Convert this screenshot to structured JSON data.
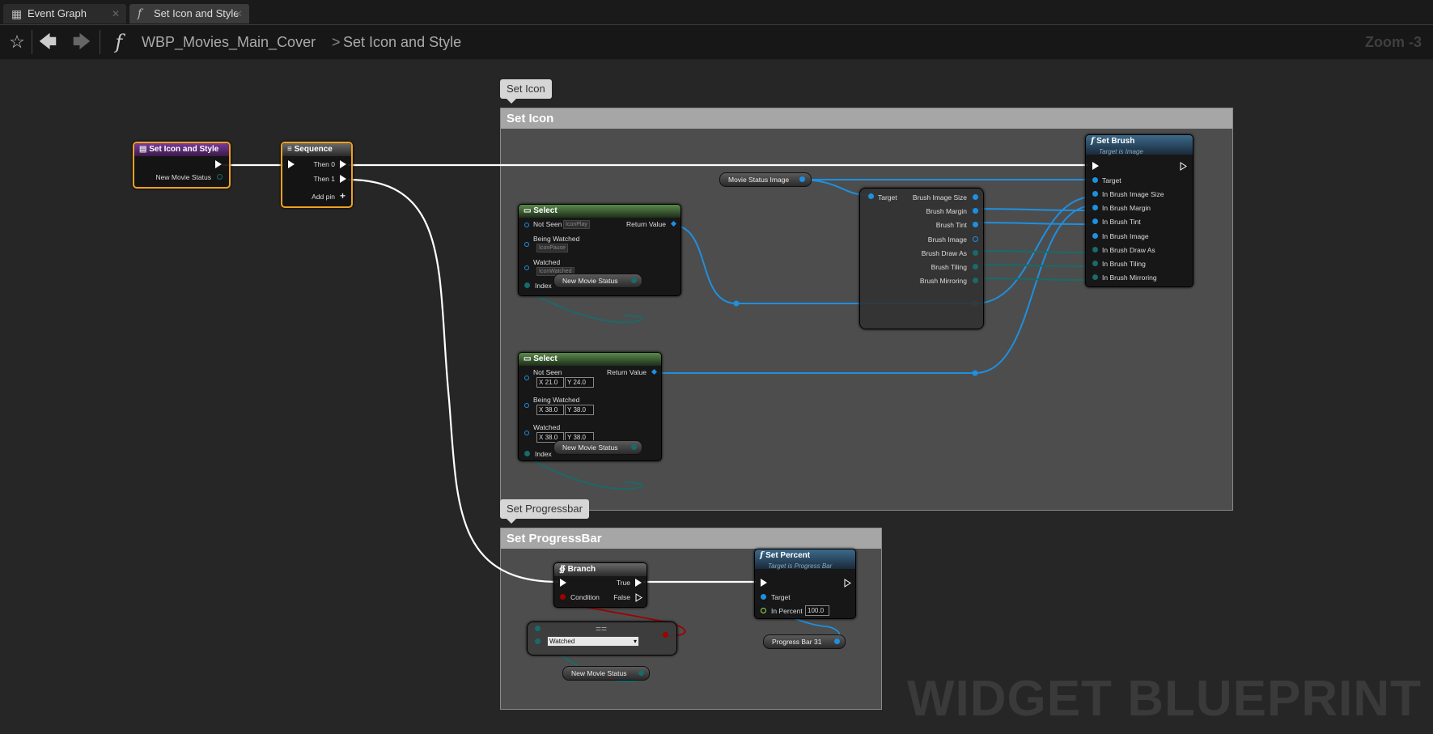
{
  "tabs": [
    {
      "label": "Event Graph",
      "icon": "grid-icon"
    },
    {
      "label": "Set Icon and Style",
      "icon": "function-icon"
    }
  ],
  "toolbar": {
    "breadcrumb_root": "WBP_Movies_Main_Cover",
    "breadcrumb_sep": ">",
    "breadcrumb_current": "Set Icon and Style",
    "zoom": "Zoom -3"
  },
  "comments": {
    "set_icon": {
      "bubble": "Set Icon",
      "title": "Set Icon"
    },
    "set_progressbar": {
      "bubble": "Set Progressbar",
      "title": "Set ProgressBar"
    }
  },
  "nodes": {
    "entry": {
      "title": "Set Icon and Style",
      "pin_new_movie_status": "New Movie Status"
    },
    "sequence": {
      "title": "Sequence",
      "then0": "Then 0",
      "then1": "Then 1",
      "add_pin": "Add pin"
    },
    "movie_status_image": {
      "label": "Movie Status Image"
    },
    "break_brush": {
      "target": "Target",
      "outputs": [
        "Brush Image Size",
        "Brush Margin",
        "Brush Tint",
        "Brush Image",
        "Brush Draw As",
        "Brush Tiling",
        "Brush Mirroring"
      ]
    },
    "set_brush": {
      "title": "Set Brush",
      "subtitle": "Target is Image",
      "inputs": [
        "Target",
        "In Brush Image Size",
        "In Brush Margin",
        "In Brush Tint",
        "In Brush Image",
        "In Brush Draw As",
        "In Brush Tiling",
        "In Brush Mirroring"
      ]
    },
    "select1": {
      "title": "Select",
      "opt1": "Not Seen",
      "opt1_val": "IconPlay",
      "opt2": "Being Watched",
      "opt2_val": "IconPause",
      "opt3": "Watched",
      "opt3_val": "IconWatched",
      "index": "Index",
      "return_value": "Return Value"
    },
    "select1_status": {
      "label": "New Movie Status"
    },
    "select2": {
      "title": "Select",
      "opt1": "Not Seen",
      "opt1_x": "21.0",
      "opt1_y": "24.0",
      "opt2": "Being Watched",
      "opt2_x": "38.0",
      "opt2_y": "38.0",
      "opt3": "Watched",
      "opt3_x": "38.0",
      "opt3_y": "38.0",
      "index": "Index",
      "return_value": "Return Value",
      "x_label": "X",
      "y_label": "Y"
    },
    "select2_status": {
      "label": "New Movie Status"
    },
    "branch": {
      "title": "Branch",
      "condition": "Condition",
      "true": "True",
      "false": "False"
    },
    "equal": {
      "title": "==",
      "enum_value": "Watched"
    },
    "equal_status": {
      "label": "New Movie Status"
    },
    "set_percent": {
      "title": "Set Percent",
      "subtitle": "Target is Progress Bar",
      "target": "Target",
      "in_percent": "In Percent",
      "percent_value": "100.0"
    },
    "progress_bar": {
      "label": "Progress Bar 31"
    }
  },
  "watermark": "WIDGET BLUEPRINT",
  "colors": {
    "exec": "#ffffff",
    "object": "#1e90e0",
    "struct": "#1a6a6a",
    "bool": "#a00000",
    "float": "#9adf5a",
    "selection": "#f0a020"
  }
}
